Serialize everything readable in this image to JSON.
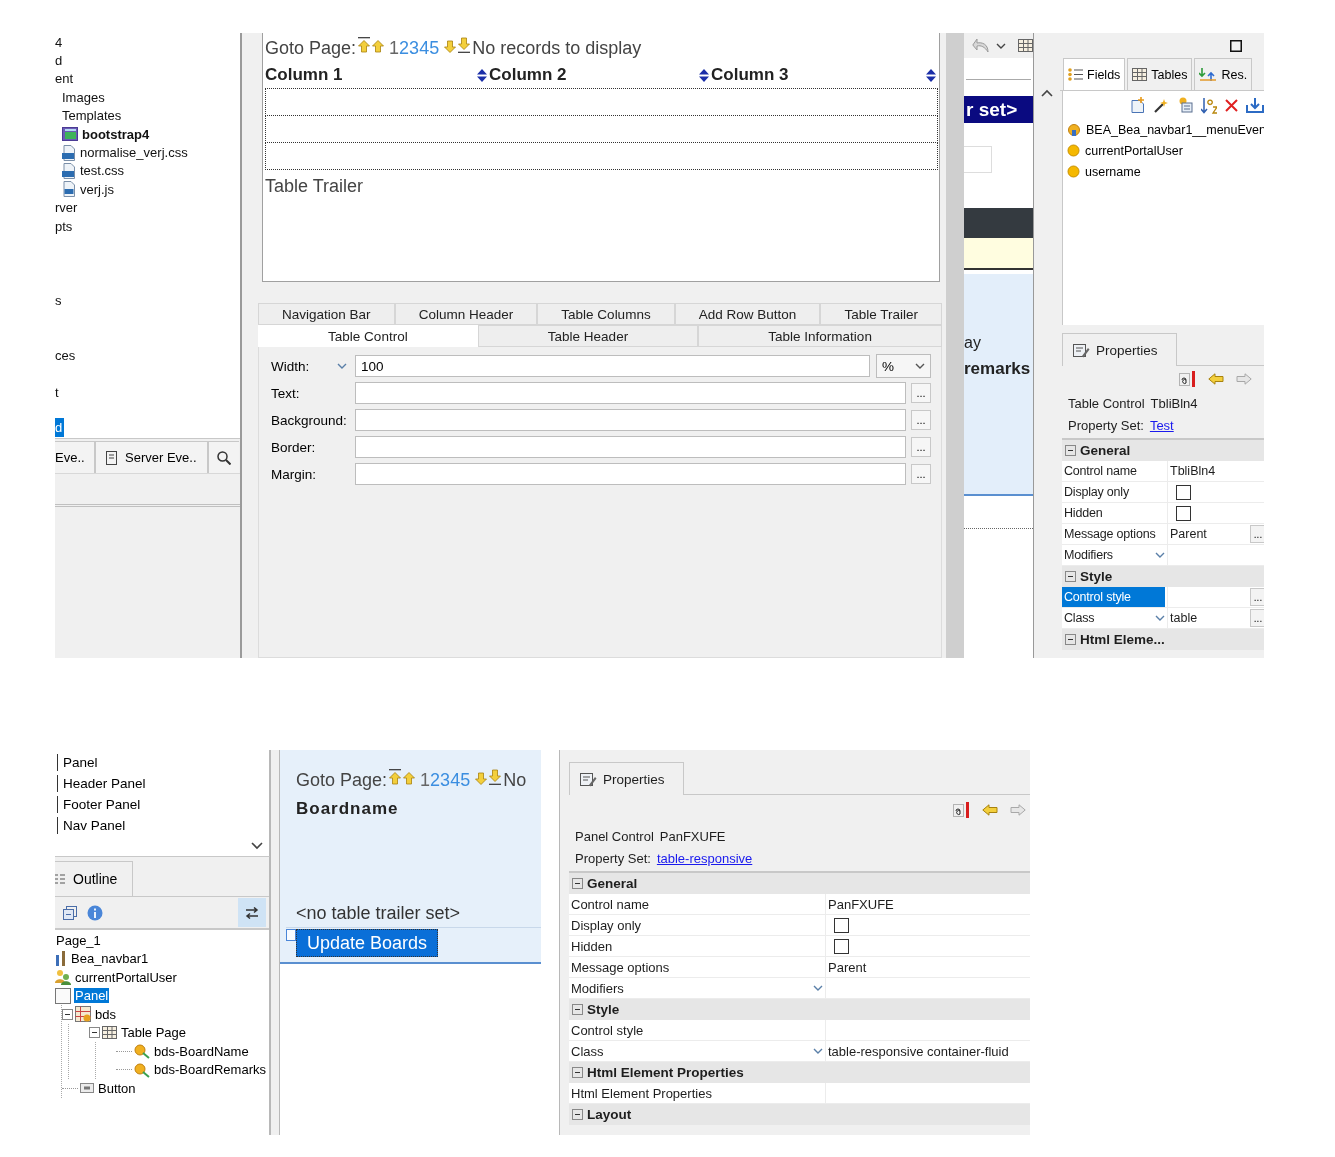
{
  "top": {
    "project_tree": {
      "items": [
        {
          "label": "4",
          "kind": "text",
          "selected": false
        },
        {
          "label": "d",
          "kind": "text",
          "selected": false
        },
        {
          "label": "ent",
          "kind": "text",
          "selected": false
        },
        {
          "label": "Images",
          "kind": "folder",
          "selected": false
        },
        {
          "label": "Templates",
          "kind": "folder",
          "selected": false
        },
        {
          "label": "bootstrap4",
          "kind": "template",
          "selected": false
        },
        {
          "label": "normalise_verj.css",
          "kind": "css",
          "selected": false
        },
        {
          "label": "test.css",
          "kind": "css",
          "selected": false
        },
        {
          "label": "verj.js",
          "kind": "js",
          "selected": false
        },
        {
          "label": "rver",
          "kind": "text",
          "selected": false
        },
        {
          "label": "pts",
          "kind": "text",
          "selected": false
        },
        {
          "label": "s",
          "kind": "text",
          "selected": false
        },
        {
          "label": "ces",
          "kind": "text",
          "selected": false
        },
        {
          "label": "t",
          "kind": "text",
          "selected": false
        },
        {
          "label": "d",
          "kind": "text",
          "selected": true
        }
      ]
    },
    "view_tabs": [
      {
        "label": "Eve..",
        "kind": "partial"
      },
      {
        "label": "Server Eve..",
        "kind": "server"
      },
      {
        "kind": "search"
      }
    ],
    "editor": {
      "nav": {
        "label": "Goto Page:",
        "pages": [
          {
            "label": "1",
            "selected": true
          },
          {
            "label": "2",
            "selected": false
          },
          {
            "label": "3",
            "selected": false
          },
          {
            "label": "4",
            "selected": false
          },
          {
            "label": "5",
            "selected": false
          }
        ],
        "message": "No records to display"
      },
      "columns": [
        "Column 1",
        "Column 2",
        "Column 3"
      ],
      "trailer": "Table Trailer",
      "tab_rows": [
        [
          {
            "label": "Navigation Bar",
            "selected": false
          },
          {
            "label": "Column Header",
            "selected": false
          },
          {
            "label": "Table Columns",
            "selected": false
          },
          {
            "label": "Add Row Button",
            "selected": false
          },
          {
            "label": "Table Trailer",
            "selected": false
          }
        ],
        [
          {
            "label": "Table Control",
            "selected": true
          },
          {
            "label": "Table Header",
            "selected": false
          },
          {
            "label": "Table Information",
            "selected": false
          }
        ]
      ],
      "form": [
        {
          "label": "Width:",
          "kind": "width",
          "value": "100",
          "unit": "%"
        },
        {
          "label": "Text:",
          "kind": "text",
          "button": "..."
        },
        {
          "label": "Background:",
          "kind": "text",
          "button": "..."
        },
        {
          "label": "Border:",
          "kind": "text",
          "button": "..."
        },
        {
          "label": "Margin:",
          "kind": "text",
          "button": "..."
        }
      ]
    },
    "design": {
      "bar_text": "r set>",
      "texts": [
        {
          "label": "ay",
          "kind": "plain"
        },
        {
          "label": "remarks",
          "kind": "bold"
        }
      ]
    },
    "fields_panel": {
      "tabs": [
        {
          "label": "Fields",
          "kind": "fields",
          "selected": true
        },
        {
          "label": "Tables",
          "kind": "tables",
          "selected": false
        },
        {
          "label": "Res.",
          "kind": "resources",
          "selected": false
        }
      ],
      "items": [
        {
          "label": "BEA_Bea_navbar1__menuEven",
          "kind": "event"
        },
        {
          "label": "currentPortalUser",
          "kind": "field"
        },
        {
          "label": "username",
          "kind": "field"
        }
      ]
    },
    "properties": {
      "tab": "Properties",
      "control_type": "Table Control",
      "control_name": "TbliBln4",
      "property_set_label": "Property Set:",
      "property_set": "Test",
      "sections": [
        {
          "title": "General",
          "expanded": true,
          "rows": [
            {
              "label": "Control name",
              "kind": "text",
              "value": "TbliBln4",
              "selected": false
            },
            {
              "label": "Display only",
              "kind": "checkbox",
              "checked": false,
              "selected": false
            },
            {
              "label": "Hidden",
              "kind": "checkbox",
              "checked": false,
              "selected": false
            },
            {
              "label": "Message options",
              "kind": "text",
              "value": "Parent",
              "button": "...",
              "selected": false
            },
            {
              "label": "Modifiers",
              "kind": "dropdown",
              "selected": false
            }
          ]
        },
        {
          "title": "Style",
          "expanded": true,
          "rows": [
            {
              "label": "Control style",
              "kind": "text",
              "button": "...",
              "selected": true
            },
            {
              "label": "Class",
              "kind": "dropdown",
              "value": "table",
              "button": "...",
              "selected": false
            }
          ]
        },
        {
          "title": "Html Eleme...",
          "expanded": true
        }
      ]
    }
  },
  "bottom": {
    "palette": {
      "items": [
        {
          "label": "Panel"
        },
        {
          "label": "Header Panel"
        },
        {
          "label": "Footer Panel"
        },
        {
          "label": "Nav Panel"
        }
      ]
    },
    "outline": {
      "tab": "Outline",
      "tree": [
        {
          "label": "Page_1",
          "kind": "page",
          "selected": false
        },
        {
          "label": "Bea_navbar1",
          "kind": "navbar",
          "selected": false
        },
        {
          "label": "currentPortalUser",
          "kind": "users",
          "selected": false
        },
        {
          "label": "Panel",
          "kind": "panel",
          "selected": true,
          "children": [
            {
              "label": "bds",
              "kind": "data",
              "selected": false,
              "expanded": true,
              "children": [
                {
                  "label": "Table Page",
                  "kind": "table",
                  "selected": false,
                  "expanded": true,
                  "children": [
                    {
                      "label": "bds-BoardName",
                      "kind": "field",
                      "selected": false
                    },
                    {
                      "label": "bds-BoardRemarks",
                      "kind": "field",
                      "selected": false
                    }
                  ]
                }
              ]
            },
            {
              "label": "Button",
              "kind": "button",
              "selected": false
            }
          ]
        }
      ]
    },
    "design": {
      "nav": {
        "label": "Goto Page:",
        "pages": [
          {
            "label": "1",
            "selected": true
          },
          {
            "label": "2",
            "selected": false
          },
          {
            "label": "3",
            "selected": false
          },
          {
            "label": "4",
            "selected": false
          },
          {
            "label": "5",
            "selected": false
          }
        ],
        "message": "No"
      },
      "column": "Boardname",
      "trailer": "<no table trailer set>",
      "button": {
        "label": "Update Boards",
        "selected": true
      }
    },
    "properties": {
      "tab": "Properties",
      "control_type": "Panel Control",
      "control_name": "PanFXUFE",
      "property_set_label": "Property Set:",
      "property_set": "table-responsive",
      "sections": [
        {
          "title": "General",
          "expanded": true,
          "rows": [
            {
              "label": "Control name",
              "kind": "text",
              "value": "PanFXUFE",
              "selected": false
            },
            {
              "label": "Display only",
              "kind": "checkbox",
              "checked": false,
              "selected": false
            },
            {
              "label": "Hidden",
              "kind": "checkbox",
              "checked": false,
              "selected": false
            },
            {
              "label": "Message options",
              "kind": "text",
              "value": "Parent",
              "selected": false
            },
            {
              "label": "Modifiers",
              "kind": "dropdown",
              "selected": false
            }
          ]
        },
        {
          "title": "Style",
          "expanded": true,
          "rows": [
            {
              "label": "Control style",
              "kind": "text",
              "selected": false
            },
            {
              "label": "Class",
              "kind": "dropdown",
              "value": "table-responsive container-fluid",
              "selected": false
            }
          ]
        },
        {
          "title": "Html Element Properties",
          "expanded": true,
          "rows": [
            {
              "label": "Html Element Properties",
              "kind": "text",
              "selected": false
            }
          ]
        },
        {
          "title": "Layout",
          "expanded": true
        }
      ]
    }
  }
}
